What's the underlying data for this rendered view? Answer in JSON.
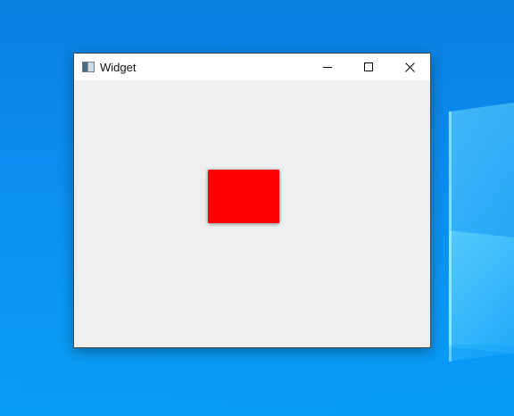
{
  "window": {
    "title": "Widget",
    "icon": "window-icon",
    "controls": {
      "minimize": "minimize-icon",
      "maximize": "maximize-icon",
      "close": "close-icon"
    }
  },
  "content": {
    "rectangle_color": "#ff0000",
    "background_color": "#efefef"
  }
}
